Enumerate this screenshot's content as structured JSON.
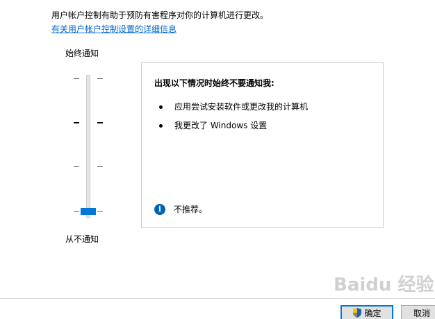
{
  "header": {
    "description": "用户帐户控制有助于预防有害程序对你的计算机进行更改。",
    "details_link": "有关用户帐户控制设置的详细信息"
  },
  "slider": {
    "top_label": "始终通知",
    "bottom_label": "从不通知",
    "levels": 4,
    "selected_level": 1
  },
  "panel": {
    "title": "出现以下情况时始终不要通知我:",
    "items": [
      "应用尝试安装软件或更改我的计算机",
      "我更改了 Windows 设置"
    ],
    "note": "不推荐。"
  },
  "buttons": {
    "ok": "确定",
    "cancel": "取消"
  },
  "watermark": "Baidu 经验",
  "colors": {
    "accent": "#0078d7",
    "link": "#0066cc",
    "info_icon": "#0063b1"
  }
}
